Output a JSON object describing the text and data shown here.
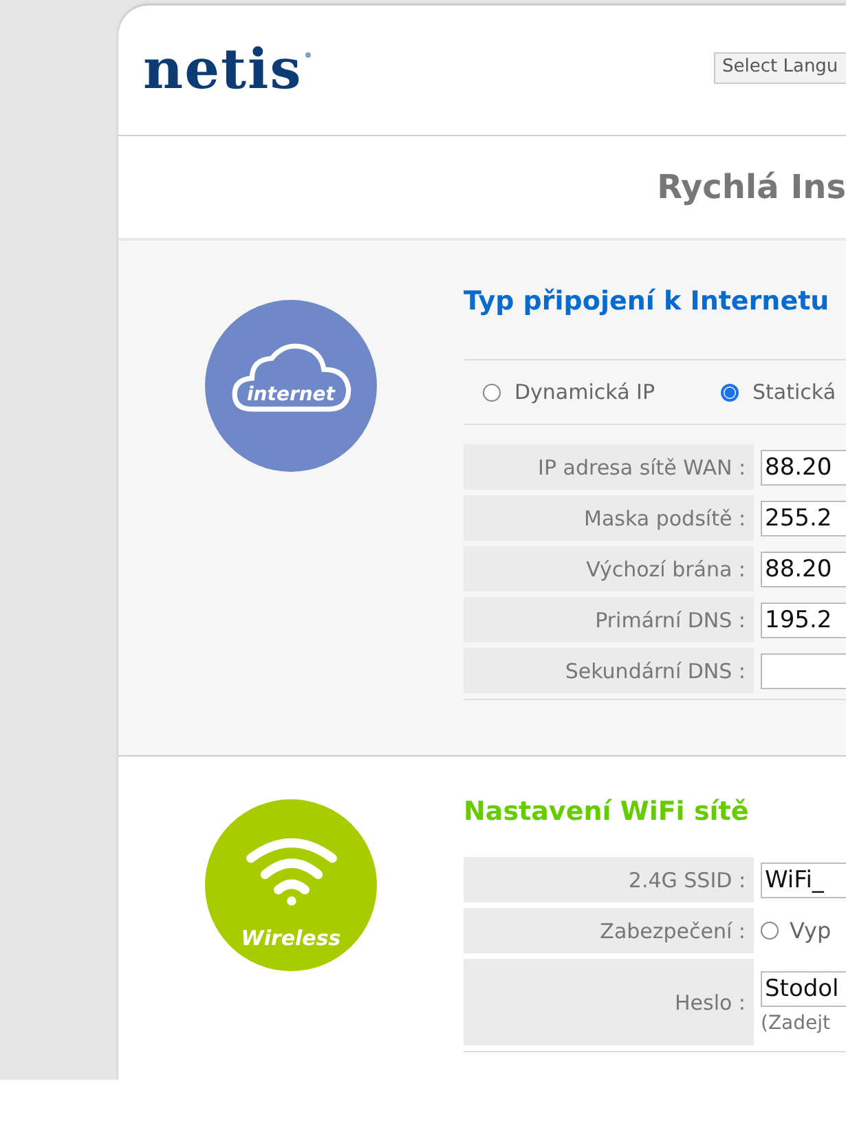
{
  "header": {
    "logo": "netis",
    "language_select": {
      "value": "Select Langu"
    }
  },
  "title": "Rychlá Ins",
  "sections": [
    {
      "kind": "internet",
      "badge_label": "internet",
      "heading": "Typ připojení k Internetu",
      "connection_types": [
        {
          "label": "Dynamická IP",
          "selected": false
        },
        {
          "label": "Statická",
          "selected": true
        }
      ],
      "fields": [
        {
          "kind": "input",
          "label": "IP adresa sítě WAN :",
          "value": "88.20"
        },
        {
          "kind": "input",
          "label": "Maska podsítě :",
          "value": "255.2"
        },
        {
          "kind": "input",
          "label": "Výchozí brána :",
          "value": "88.20"
        },
        {
          "kind": "input",
          "label": "Primární DNS :",
          "value": "195.2"
        },
        {
          "kind": "input",
          "label": "Sekundární DNS :"
        }
      ]
    },
    {
      "kind": "wifi",
      "badge_label": "Wireless",
      "heading": "Nastavení WiFi sítě",
      "fields": [
        {
          "kind": "input",
          "label": "2.4G SSID :",
          "value": "WiFi_"
        },
        {
          "kind": "radio",
          "label": "Zabezpečení :",
          "options": [
            {
              "label": "Vyp",
              "selected": false
            }
          ]
        },
        {
          "kind": "input",
          "label": "Heslo :",
          "value": "Stodol",
          "hint": "(Zadejt"
        }
      ]
    }
  ]
}
